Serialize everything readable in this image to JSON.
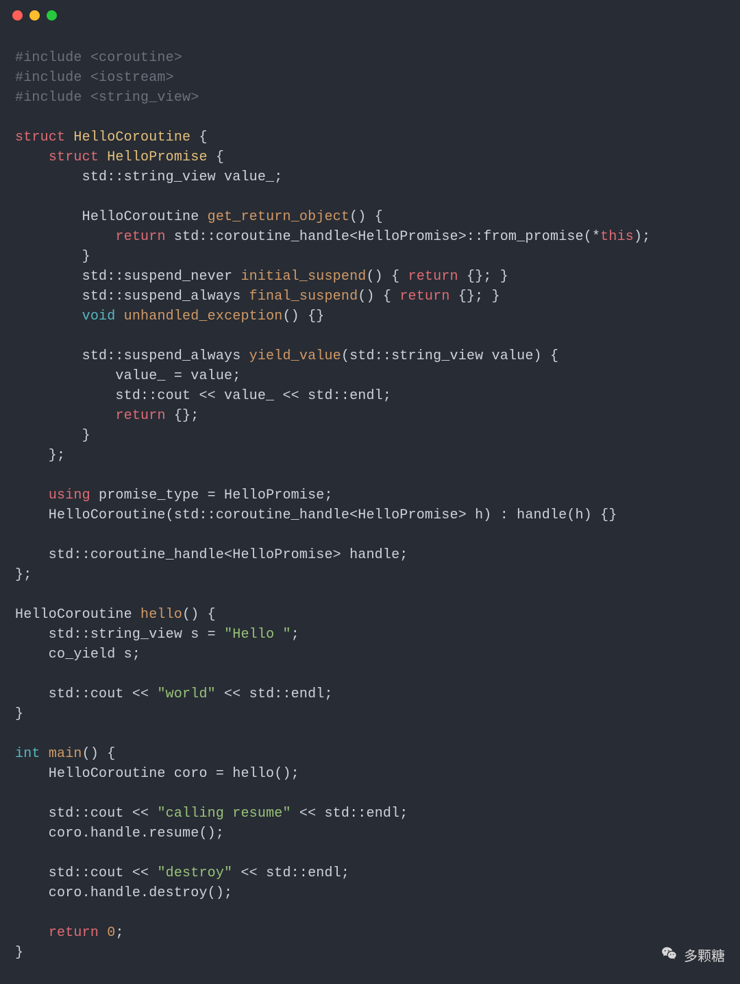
{
  "titlebar": {
    "dots": [
      "close",
      "minimize",
      "zoom"
    ]
  },
  "code": {
    "l1_inc1": "#include <coroutine>",
    "l2_inc2": "#include <iostream>",
    "l3_inc3": "#include <string_view>",
    "l5_struct": "struct",
    "l5_name": " HelloCoroutine",
    "l5_rest": " {",
    "l6_lead": "    ",
    "l6_struct": "struct",
    "l6_name": " HelloPromise",
    "l6_rest": " {",
    "l7": "        std::string_view value_;",
    "l9_lead": "        HelloCoroutine ",
    "l9_fn": "get_return_object",
    "l9_rest": "() {",
    "l10_lead": "            ",
    "l10_ret": "return",
    "l10_mid": " std::coroutine_handle<HelloPromise>::from_promise(*",
    "l10_this": "this",
    "l10_end": ");",
    "l11": "        }",
    "l12_lead": "        std::suspend_never ",
    "l12_fn": "initial_suspend",
    "l12_mid": "() { ",
    "l12_ret": "return",
    "l12_end": " {}; }",
    "l13_lead": "        std::suspend_always ",
    "l13_fn": "final_suspend",
    "l13_mid": "() { ",
    "l13_ret": "return",
    "l13_end": " {}; }",
    "l14_lead": "        ",
    "l14_void": "void",
    "l14_sp": " ",
    "l14_fn": "unhandled_exception",
    "l14_end": "() {}",
    "l16_lead": "        std::suspend_always ",
    "l16_fn": "yield_value",
    "l16_end": "(std::string_view value) {",
    "l17": "            value_ = value;",
    "l18": "            std::cout << value_ << std::endl;",
    "l19_lead": "            ",
    "l19_ret": "return",
    "l19_end": " {};",
    "l20": "        }",
    "l21": "    };",
    "l23_lead": "    ",
    "l23_using": "using",
    "l23_end": " promise_type = HelloPromise;",
    "l24": "    HelloCoroutine(std::coroutine_handle<HelloPromise> h) : handle(h) {}",
    "l26": "    std::coroutine_handle<HelloPromise> handle;",
    "l27": "};",
    "l29_lead": "HelloCoroutine ",
    "l29_fn": "hello",
    "l29_end": "() {",
    "l30_lead": "    std::string_view s = ",
    "l30_str": "\"Hello \"",
    "l30_end": ";",
    "l31": "    co_yield s;",
    "l33_lead": "    std::cout << ",
    "l33_str": "\"world\"",
    "l33_end": " << std::endl;",
    "l34": "}",
    "l36_int": "int",
    "l36_sp": " ",
    "l36_fn": "main",
    "l36_end": "() {",
    "l37": "    HelloCoroutine coro = hello();",
    "l39_lead": "    std::cout << ",
    "l39_str": "\"calling resume\"",
    "l39_end": " << std::endl;",
    "l40": "    coro.handle.resume();",
    "l42_lead": "    std::cout << ",
    "l42_str": "\"destroy\"",
    "l42_end": " << std::endl;",
    "l43": "    coro.handle.destroy();",
    "l45_lead": "    ",
    "l45_ret": "return",
    "l45_sp": " ",
    "l45_num": "0",
    "l45_end": ";",
    "l46": "}"
  },
  "watermark": {
    "text": "多颗糖",
    "icon": "wechat-icon"
  }
}
